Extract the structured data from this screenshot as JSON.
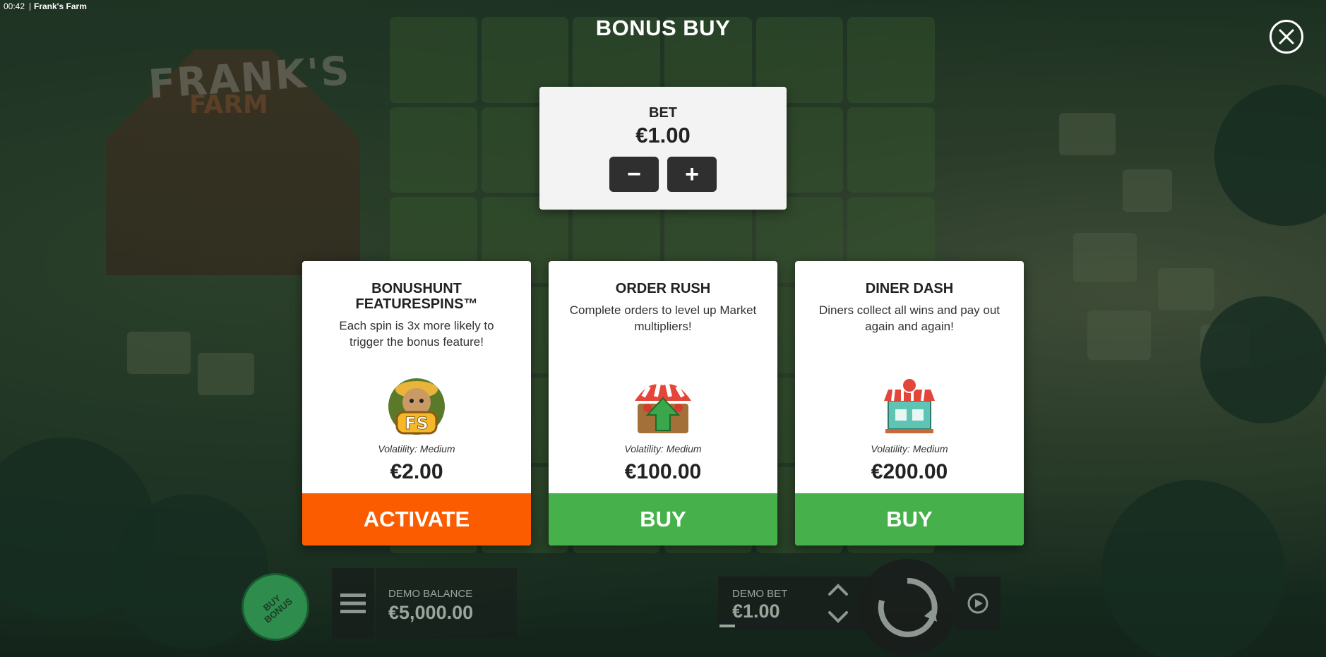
{
  "status_bar": {
    "time": "00:42",
    "game_name": "Frank's Farm"
  },
  "modal": {
    "title": "BONUS BUY",
    "bet": {
      "label": "BET",
      "value": "€1.00",
      "minus": "−",
      "plus": "+"
    }
  },
  "options": [
    {
      "name": "BONUSHUNT FEATURESPINS™",
      "description": "Each spin is 3x more likely to trigger the bonus feature!",
      "icon": "sloth-fs-icon",
      "volatility": "Volatility: Medium",
      "price": "€2.00",
      "cta": "ACTIVATE",
      "cta_color": "#fc5c00"
    },
    {
      "name": "ORDER RUSH",
      "description": "Complete orders to level up Market multipliers!",
      "icon": "market-stall-icon",
      "volatility": "Volatility: Medium",
      "price": "€100.00",
      "cta": "BUY",
      "cta_color": "#46b14a"
    },
    {
      "name": "DINER DASH",
      "description": "Diners collect all wins and pay out again and again!",
      "icon": "diner-icon",
      "volatility": "Volatility: Medium",
      "price": "€200.00",
      "cta": "BUY",
      "cta_color": "#46b14a"
    }
  ],
  "bottom_bar": {
    "buy_bonus": "BUY BONUS",
    "balance_label": "DEMO BALANCE",
    "balance_value": "€5,000.00",
    "bet_label": "DEMO BET",
    "bet_value": "€1.00"
  },
  "background_logo": {
    "line1": "FRANK'S",
    "line2": "FARM"
  }
}
